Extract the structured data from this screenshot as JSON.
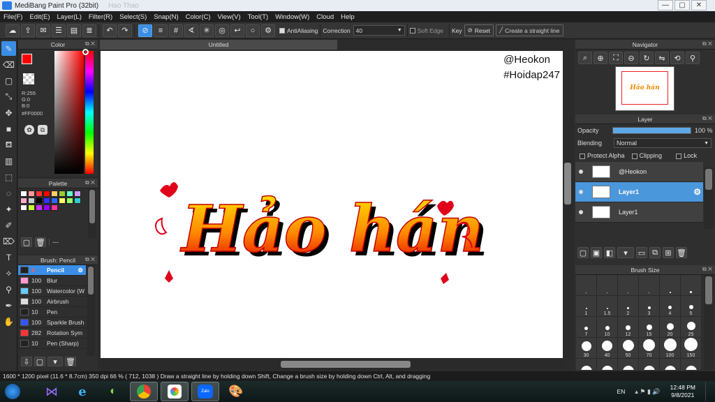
{
  "window": {
    "title": "MediBang Paint Pro (32bit)",
    "ghost_title": "Hao Thao",
    "controls": [
      "—",
      "▢",
      "✕"
    ]
  },
  "menu": [
    "File(F)",
    "Edit(E)",
    "Layer(L)",
    "Filter(R)",
    "Select(S)",
    "Snap(N)",
    "Color(C)",
    "View(V)",
    "Tool(T)",
    "Window(W)",
    "Cloud",
    "Help"
  ],
  "toolbar": {
    "antialiasing": "AntiAliasing",
    "correction_label": "Correction",
    "correction_value": "40",
    "soft_edge": "Soft Edge",
    "key_label": "Key",
    "reset": "Reset",
    "straight_line": "Create a straight line"
  },
  "color_panel": {
    "title": "Color",
    "r": "R:255",
    "g": "G:0",
    "b": "B:0",
    "hex": "#FF0000",
    "primary": "#ff0000"
  },
  "palette_panel": {
    "title": "Palette",
    "swatches": [
      "#ffffff",
      "#ff9999",
      "#ff3333",
      "#ff0000",
      "#ffcc66",
      "#99cc33",
      "#66ffcc",
      "#cc99ff",
      "#ffaacc",
      "#cccccc",
      "#000000",
      "#3333ff",
      "#3366ff",
      "#ffff66",
      "#99ff66",
      "#33cccc",
      "#ffffff",
      "#ccff33",
      "#cc33ff",
      "#9900ff",
      "#ff3399"
    ],
    "footer": "---"
  },
  "brush_panel": {
    "title": "Brush: Pencil",
    "items": [
      {
        "size": "4",
        "name": "Pencil",
        "color": "#222222"
      },
      {
        "size": "100",
        "name": "Blur",
        "color": "#ff99cc"
      },
      {
        "size": "100",
        "name": "Watercolor (W",
        "color": "#66ccff"
      },
      {
        "size": "100",
        "name": "Airbrush",
        "color": "#dddddd"
      },
      {
        "size": "10",
        "name": "Pen",
        "color": "#222222"
      },
      {
        "size": "100",
        "name": "Sparkle Brush",
        "color": "#3355ff"
      },
      {
        "size": "282",
        "name": "Rotation Sym",
        "color": "#ff3333"
      },
      {
        "size": "10",
        "name": "Pen (Sharp)",
        "color": "#222222"
      }
    ]
  },
  "document": {
    "tab": "Untitled"
  },
  "canvas": {
    "watermark_1": "@Heokon",
    "watermark_2": "#Hoidap247",
    "art_text": "Hảo hán"
  },
  "navigator": {
    "title": "Navigator",
    "preview_text": "Hảo hán"
  },
  "layer_panel": {
    "title": "Layer",
    "opacity_label": "Opacity",
    "opacity_value": "100 %",
    "opacity_fraction": 1.0,
    "blending_label": "Blending",
    "blending_value": "Normal",
    "protect_alpha": "Protect Alpha",
    "clipping": "Clipping",
    "lock": "Lock",
    "layers": [
      {
        "name": "@Heokon"
      },
      {
        "name": "Layer1"
      },
      {
        "name": "Layer1"
      }
    ]
  },
  "brush_size_panel": {
    "title": "Brush Size",
    "sizes": [
      "",
      "",
      "",
      "",
      "",
      "",
      "1",
      "1.5",
      "2",
      "3",
      "4",
      "5",
      "7",
      "10",
      "12",
      "15",
      "20",
      "25",
      "30",
      "40",
      "50",
      "70",
      "100",
      "150",
      "",
      "",
      "",
      "",
      "",
      ""
    ]
  },
  "statusbar": {
    "text": "1600 * 1200 pixel   (11.6 * 8.7cm)   350 dpi   66 %   ( 712, 1038 )   Draw a straight line by holding down Shift, Change a brush size by holding down Ctrl, Alt, and dragging"
  },
  "taskbar": {
    "lang": "EN",
    "time": "12:48 PM",
    "date": "9/8/2021"
  }
}
